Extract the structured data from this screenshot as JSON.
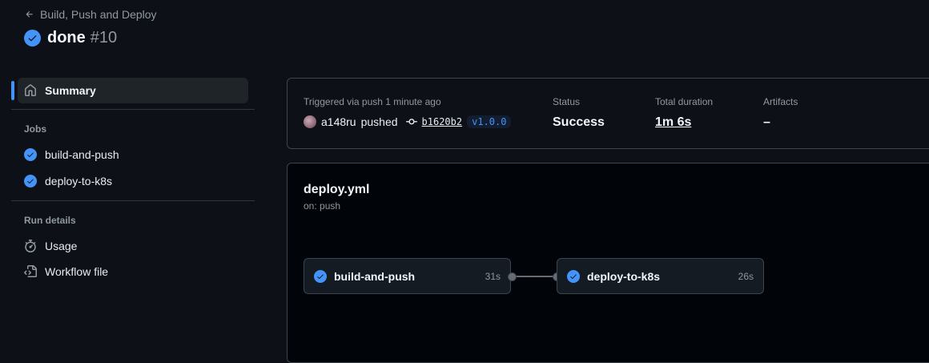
{
  "header": {
    "back_label": "Build, Push and Deploy",
    "run_name": "done",
    "run_number": "#10"
  },
  "sidebar": {
    "summary_label": "Summary",
    "jobs_heading": "Jobs",
    "jobs": [
      {
        "label": "build-and-push"
      },
      {
        "label": "deploy-to-k8s"
      }
    ],
    "run_details_heading": "Run details",
    "usage_label": "Usage",
    "workflow_file_label": "Workflow file"
  },
  "summary": {
    "trigger_text": "Triggered via push 1 minute ago",
    "actor": "a148ru",
    "action": "pushed",
    "commit_sha": "b1620b2",
    "tag": "v1.0.0",
    "status_label": "Status",
    "status_value": "Success",
    "duration_label": "Total duration",
    "duration_value": "1m 6s",
    "artifacts_label": "Artifacts",
    "artifacts_value": "–"
  },
  "graph": {
    "file": "deploy.yml",
    "trigger": "on: push",
    "jobs": [
      {
        "name": "build-and-push",
        "duration": "31s",
        "status": "success"
      },
      {
        "name": "deploy-to-k8s",
        "duration": "26s",
        "status": "success"
      }
    ]
  },
  "colors": {
    "accent": "#4493f8",
    "background": "#0d1117",
    "graph_background": "#010409"
  }
}
